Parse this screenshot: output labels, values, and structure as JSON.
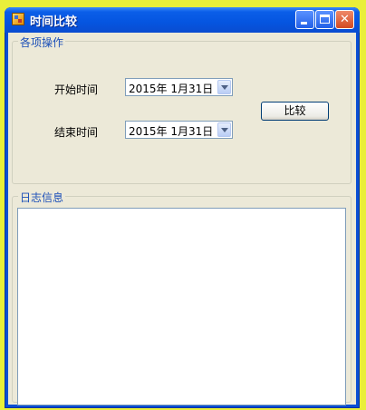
{
  "window": {
    "title": "时间比较",
    "buttons": {
      "minimize": "minimize",
      "maximize": "maximize",
      "close": "✕"
    }
  },
  "ops_group": {
    "title": "各项操作",
    "start_label": "开始时间",
    "end_label": "结束时间",
    "start_date": "2015年  1月31日",
    "end_date": "2015年  1月31日",
    "compare_label": "比较"
  },
  "log_group": {
    "title": "日志信息",
    "content": ""
  },
  "icons": {
    "app": "app-icon",
    "dropdown": "chevron-down-icon"
  },
  "colors": {
    "titlebar": "#0a4fd4",
    "client": "#ece9d8",
    "group_title": "#1b4fb8",
    "close_button": "#d24a22"
  }
}
